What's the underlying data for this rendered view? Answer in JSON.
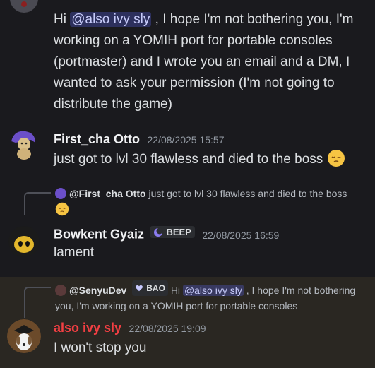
{
  "messages": [
    {
      "text_parts": [
        "Hi ",
        "@also ivy sly",
        " , I hope I'm not bothering you, I'm working on a YOMIH port for portable consoles (portmaster) and I wrote you an email and a DM, I wanted to ask your permission (I'm not going to distribute the game)"
      ]
    },
    {
      "author": "First_cha Otto",
      "timestamp": "22/08/2025 15:57",
      "text": "just got to lvl 30 flawless and died to the boss",
      "emoji": "relieved-face-emoji"
    },
    {
      "reply": {
        "author": "@First_cha Otto",
        "text": "just got to lvl 30 flawless and died to the boss"
      },
      "author": "Bowkent Gyaiz",
      "tag": "BEEP",
      "timestamp": "22/08/2025 16:59",
      "text": "lament"
    },
    {
      "reply": {
        "author": "@SenyuDev",
        "tag": "BAO",
        "text_parts": [
          "Hi ",
          "@also ivy sly",
          " , I hope I'm not bothering",
          "you, I'm working on a YOMIH port for portable consoles"
        ]
      },
      "author": "also ivy sly",
      "author_color": "#f23f43",
      "timestamp": "22/08/2025 19:09",
      "text": "I won't stop you"
    }
  ],
  "colors": {
    "background": "#1a1a1e",
    "mention_bg": "#3c4270",
    "highlight_bg": "#2a2722",
    "author_red": "#f23f43"
  }
}
